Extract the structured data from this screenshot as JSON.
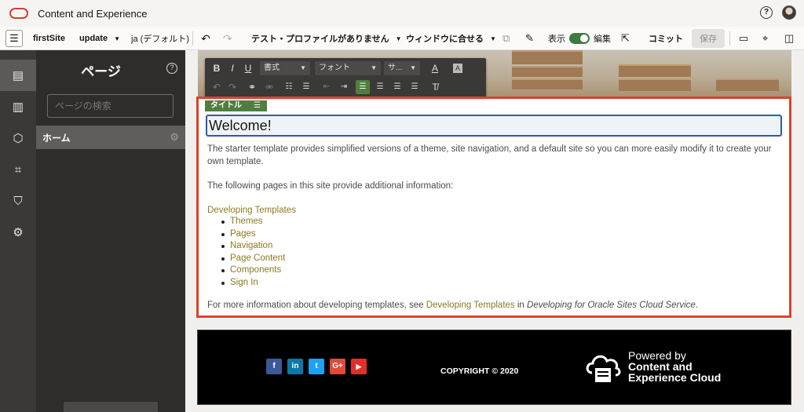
{
  "app": {
    "title": "Content and Experience"
  },
  "toolbar": {
    "site": "firstSite",
    "update": "update",
    "language": "ja (デフォルト)",
    "profile": "テスト・プロファイルがありません",
    "window": "ウィンドウに合せる",
    "view_label": "表示",
    "edit_label": "編集",
    "commit": "コミット",
    "save": "保存"
  },
  "panel": {
    "title": "ページ",
    "search_placeholder": "ページの検索",
    "pages": [
      "ホーム"
    ]
  },
  "rte": {
    "format": "書式",
    "font": "フォント",
    "size": "サ..."
  },
  "component": {
    "tag": "タイトル",
    "title": "Welcome!"
  },
  "content": {
    "para1": "The starter template provides simplified versions of a theme, site navigation, and a default site so you can more easily modify it to create your own template.",
    "para2": "The following pages in this site provide additional information:",
    "dev_link": "Developing Templates",
    "links": [
      "Themes",
      "Pages",
      "Navigation",
      "Page Content",
      "Components",
      "Sign In"
    ],
    "more_prefix": "For more information about developing templates, see ",
    "more_link": "Developing Templates",
    "more_mid": " in ",
    "more_book": "Developing for Oracle Sites Cloud Service",
    "more_end": "."
  },
  "footer": {
    "social": [
      "f",
      "in",
      "t",
      "G+",
      "▶"
    ],
    "social_colors": [
      "#3b5998",
      "#0e76a8",
      "#1da1f2",
      "#dd4b39",
      "#e52d27"
    ],
    "copyright": "COPYRIGHT © 2020",
    "powered_1": "Powered by",
    "powered_2": "Content and",
    "powered_3": "Experience Cloud"
  },
  "accent": {
    "oracle_red": "#c74634",
    "select_red": "#d9432c",
    "green": "#4f7f3f",
    "link": "#8a7a22"
  }
}
